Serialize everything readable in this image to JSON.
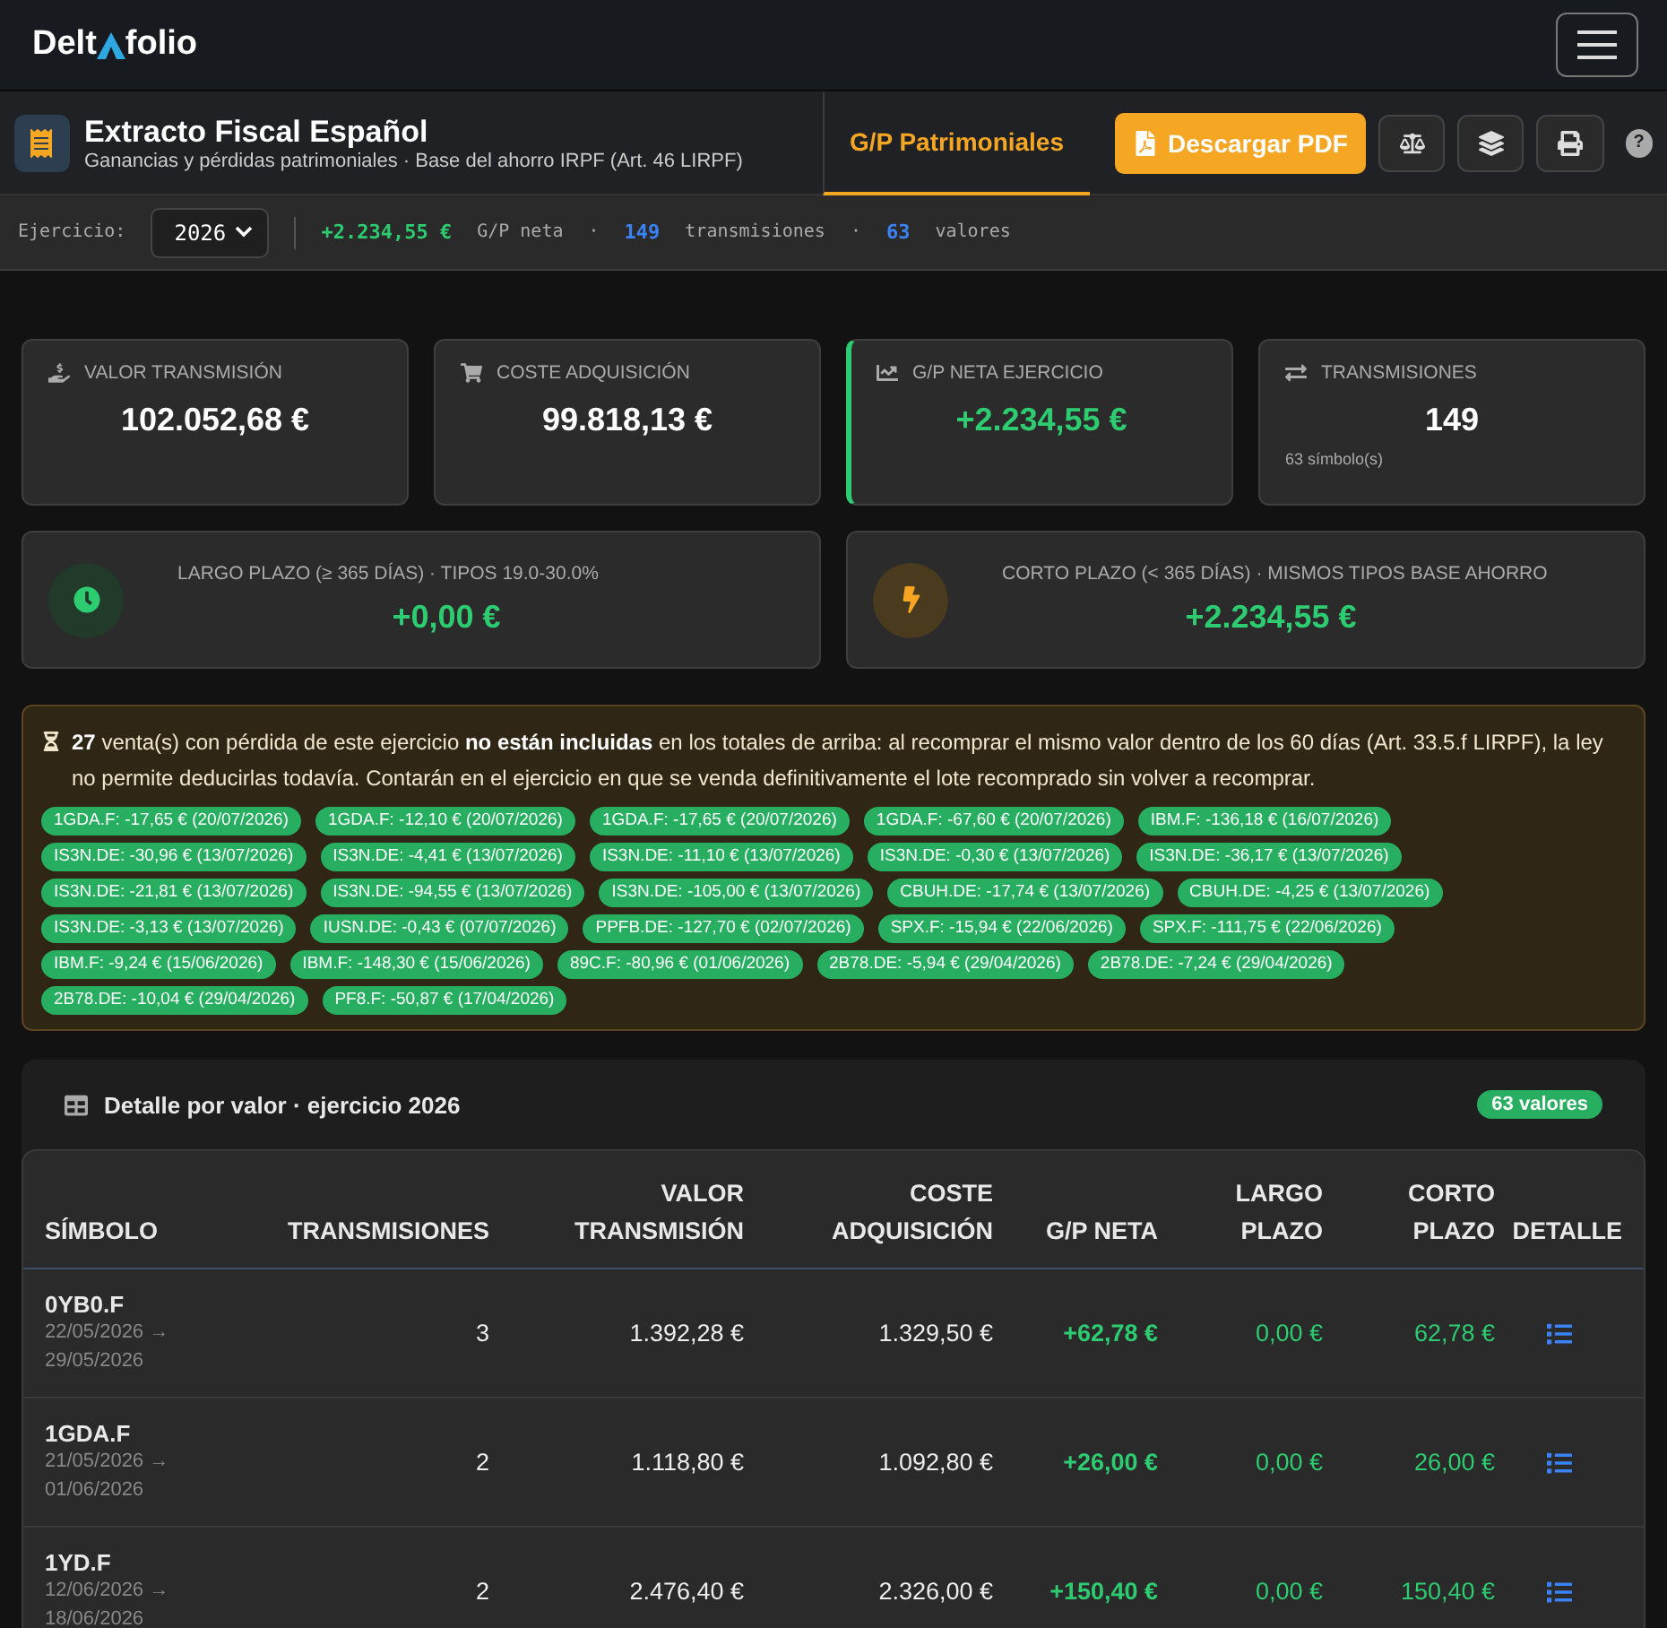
{
  "brand": {
    "before": "Delt",
    "after": "folio"
  },
  "header": {
    "title": "Extracto Fiscal Español",
    "subtitle": "Ganancias y pérdidas patrimoniales · Base del ahorro IRPF (Art. 46 LIRPF)",
    "tabs": [
      {
        "label": "G/P Patrimoniales",
        "selected": true
      }
    ],
    "download": "Descargar PDF",
    "help": "?"
  },
  "filter": {
    "label": "Ejercicio:",
    "year": "2026",
    "net": "+2.234,55 €",
    "net_label": "G/P neta",
    "sep1": "·",
    "count": "149",
    "count_label": "transmisiones",
    "sep2": "·",
    "values": "63",
    "values_label": "valores"
  },
  "kpis": [
    {
      "kind": "transfer",
      "label": "VALOR TRANSMISIÓN",
      "value": "102.052,68 €",
      "positive": false,
      "accent": false
    },
    {
      "kind": "cart",
      "label": "COSTE ADQUISICIÓN",
      "value": "99.818,13 €",
      "positive": false,
      "accent": false
    },
    {
      "kind": "chart",
      "label": "G/P NETA EJERCICIO",
      "value": "+2.234,55 €",
      "positive": true,
      "accent": true
    },
    {
      "kind": "swap",
      "label": "TRANSMISIONES",
      "value": "149",
      "positive": false,
      "accent": false,
      "note": "63 símbolo(s)"
    }
  ],
  "terms": [
    {
      "kind": "long",
      "label": "LARGO PLAZO (≥ 365 DÍAS) · TIPOS 19.0-30.0%",
      "value": "+0,00 €"
    },
    {
      "kind": "short",
      "label": "CORTO PLAZO (< 365 DÍAS) · MISMOS TIPOS BASE AHORRO",
      "value": "+2.234,55 €"
    }
  ],
  "warning": {
    "text": "**27** venta(s) con pérdida de este ejercicio **no están incluidas** en los totales de arriba: al recomprar el mismo valor dentro de los 60 días (Art. 33.5.f LIRPF), la ley no permite deducirlas todavía. Contarán en el ejercicio en que se venda definitivamente el lote recomprado sin volver a recomprar.",
    "tags": [
      "1GDA.F: -17,65 € (20/07/2026)",
      "1GDA.F: -12,10 € (20/07/2026)",
      "1GDA.F: -17,65 € (20/07/2026)",
      "1GDA.F: -67,60 € (20/07/2026)",
      "IBM.F: -136,18 € (16/07/2026)",
      "IS3N.DE: -30,96 € (13/07/2026)",
      "IS3N.DE: -4,41 € (13/07/2026)",
      "IS3N.DE: -11,10 € (13/07/2026)",
      "IS3N.DE: -0,30 € (13/07/2026)",
      "IS3N.DE: -36,17 € (13/07/2026)",
      "IS3N.DE: -21,81 € (13/07/2026)",
      "IS3N.DE: -94,55 € (13/07/2026)",
      "IS3N.DE: -105,00 € (13/07/2026)",
      "CBUH.DE: -17,74 € (13/07/2026)",
      "CBUH.DE: -4,25 € (13/07/2026)",
      "IS3N.DE: -3,13 € (13/07/2026)",
      "IUSN.DE: -0,43 € (07/07/2026)",
      "PPFB.DE: -127,70 € (02/07/2026)",
      "SPX.F: -15,94 € (22/06/2026)",
      "SPX.F: -111,75 € (22/06/2026)",
      "IBM.F: -9,24 € (15/06/2026)",
      "IBM.F: -148,30 € (15/06/2026)",
      "89C.F: -80,96 € (01/06/2026)",
      "2B78.DE: -5,94 € (29/04/2026)",
      "2B78.DE: -7,24 € (29/04/2026)",
      "2B78.DE: -10,04 € (29/04/2026)",
      "PF8.F: -50,87 € (17/04/2026)"
    ]
  },
  "table": {
    "title": "Detalle por valor · ejercicio 2026",
    "badge": "63 valores",
    "columns": [
      [
        "SÍMBOLO"
      ],
      [
        "TRANSMISIONES"
      ],
      [
        "VALOR",
        "TRANSMISIÓN"
      ],
      [
        "COSTE",
        "ADQUISICIÓN"
      ],
      [
        "G/P NETA"
      ],
      [
        "LARGO",
        "PLAZO"
      ],
      [
        "CORTO",
        "PLAZO"
      ],
      [
        "DETALLE"
      ]
    ],
    "rows": [
      {
        "symbol": "0YB0.F",
        "from": "22/05/2026 →",
        "to": "29/05/2026",
        "count": "3",
        "value": "1.392,28 €",
        "cost": "1.329,50 €",
        "net": "+62,78 €",
        "long": "0,00 €",
        "short": "62,78 €"
      },
      {
        "symbol": "1GDA.F",
        "from": "21/05/2026 →",
        "to": "01/06/2026",
        "count": "2",
        "value": "1.118,80 €",
        "cost": "1.092,80 €",
        "net": "+26,00 €",
        "long": "0,00 €",
        "short": "26,00 €"
      },
      {
        "symbol": "1YD.F",
        "from": "12/06/2026 →",
        "to": "18/06/2026",
        "count": "2",
        "value": "2.476,40 €",
        "cost": "2.326,00 €",
        "net": "+150,40 €",
        "long": "0,00 €",
        "short": "150,40 €"
      }
    ]
  }
}
